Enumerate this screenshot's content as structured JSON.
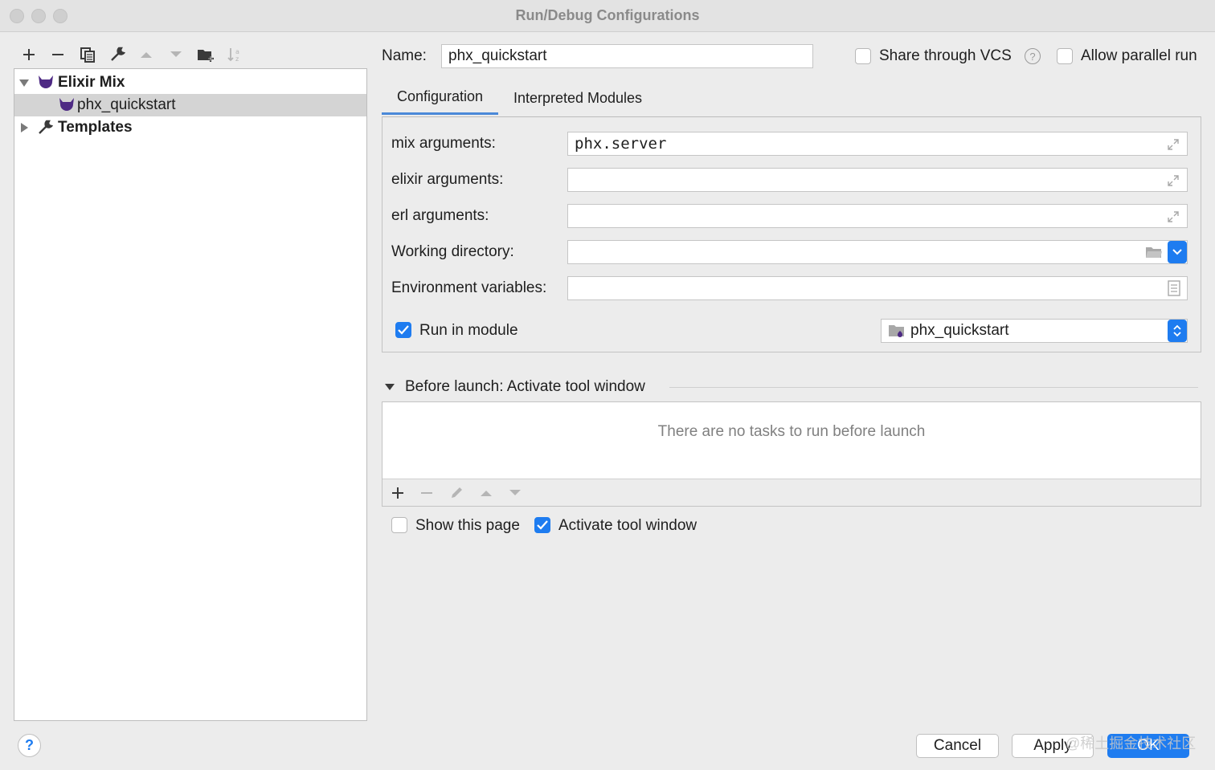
{
  "window": {
    "title": "Run/Debug Configurations"
  },
  "toolbar": {
    "icons": [
      "plus-icon",
      "minus-icon",
      "copy-icon",
      "wrench-icon",
      "arrow-up-icon",
      "arrow-down-icon",
      "folder-add-icon",
      "sort-icon"
    ]
  },
  "tree": {
    "items": [
      {
        "label": "Elixir Mix",
        "icon": "elixir-icon",
        "expanded": true
      },
      {
        "label": "phx_quickstart",
        "icon": "elixir-icon",
        "selected": true
      },
      {
        "label": "Templates",
        "icon": "wrench-icon",
        "expanded": false
      }
    ]
  },
  "header": {
    "name_label": "Name:",
    "name_value": "phx_quickstart",
    "share_vcs_label": "Share through VCS",
    "share_vcs_checked": false,
    "allow_parallel_label": "Allow parallel run",
    "allow_parallel_checked": false
  },
  "tabs": [
    {
      "label": "Configuration",
      "active": true
    },
    {
      "label": "Interpreted Modules",
      "active": false
    }
  ],
  "config": {
    "mix_arguments_label": "mix arguments:",
    "mix_arguments_value": "phx.server",
    "elixir_arguments_label": "elixir arguments:",
    "elixir_arguments_value": "",
    "erl_arguments_label": "erl arguments:",
    "erl_arguments_value": "",
    "working_directory_label": "Working directory:",
    "working_directory_value": "",
    "environment_variables_label": "Environment variables:",
    "environment_variables_value": "",
    "run_in_module_label": "Run in module",
    "run_in_module_checked": true,
    "module_value": "phx_quickstart"
  },
  "before_launch": {
    "title": "Before launch: Activate tool window",
    "empty_text": "There are no tasks to run before launch",
    "show_page_label": "Show this page",
    "show_page_checked": false,
    "activate_tool_label": "Activate tool window",
    "activate_tool_checked": true
  },
  "footer": {
    "help_label": "?",
    "cancel_label": "Cancel",
    "apply_label": "Apply",
    "ok_label": "OK"
  },
  "watermark": "@稀土掘金技术社区",
  "colors": {
    "accent": "#1e7cf0",
    "elixir": "#4e2a84",
    "selection": "#d4d4d4"
  }
}
